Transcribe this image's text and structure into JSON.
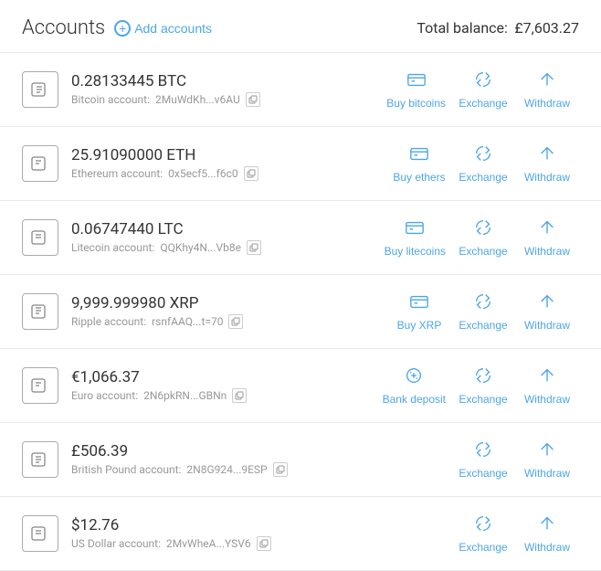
{
  "header": {
    "title": "Accounts",
    "add_label": "Add accounts",
    "total_label": "Total balance:",
    "total_value": "£7,603.27"
  },
  "accounts": [
    {
      "id": "btc",
      "amount": "0.28133445 BTC",
      "type_label": "Bitcoin account:",
      "address": "2MuWdKh...v6AU",
      "icon_type": "btc",
      "actions": [
        "Buy bitcoins",
        "Exchange",
        "Withdraw"
      ],
      "has_buy": true,
      "buy_label": "Buy bitcoins"
    },
    {
      "id": "eth",
      "amount": "25.91090000 ETH",
      "type_label": "Ethereum account:",
      "address": "0x5ecf5...f6c0",
      "icon_type": "eth",
      "actions": [
        "Buy ethers",
        "Exchange",
        "Withdraw"
      ],
      "has_buy": true,
      "buy_label": "Buy ethers"
    },
    {
      "id": "ltc",
      "amount": "0.06747440 LTC",
      "type_label": "Litecoin account:",
      "address": "QQKhy4N...Vb8e",
      "icon_type": "ltc",
      "actions": [
        "Buy litecoins",
        "Exchange",
        "Withdraw"
      ],
      "has_buy": true,
      "buy_label": "Buy litecoins"
    },
    {
      "id": "xrp",
      "amount": "9,999.999980 XRP",
      "type_label": "Ripple account:",
      "address": "rsnfAAQ...t=70",
      "icon_type": "xrp",
      "actions": [
        "Buy XRP",
        "Exchange",
        "Withdraw"
      ],
      "has_buy": true,
      "buy_label": "Buy XRP"
    },
    {
      "id": "eur",
      "amount": "€1,066.37",
      "type_label": "Euro account:",
      "address": "2N6pkRN...GBNn",
      "icon_type": "eur",
      "actions": [
        "Bank deposit",
        "Exchange",
        "Withdraw"
      ],
      "has_buy": true,
      "buy_label": "Bank deposit"
    },
    {
      "id": "gbp",
      "amount": "£506.39",
      "type_label": "British Pound account:",
      "address": "2N8G924...9ESP",
      "icon_type": "gbp",
      "actions": [
        "Exchange",
        "Withdraw"
      ],
      "has_buy": false
    },
    {
      "id": "usd",
      "amount": "$12.76",
      "type_label": "US Dollar account:",
      "address": "2MvWheA...YSV6",
      "icon_type": "usd",
      "actions": [
        "Exchange",
        "Withdraw"
      ],
      "has_buy": false
    }
  ]
}
